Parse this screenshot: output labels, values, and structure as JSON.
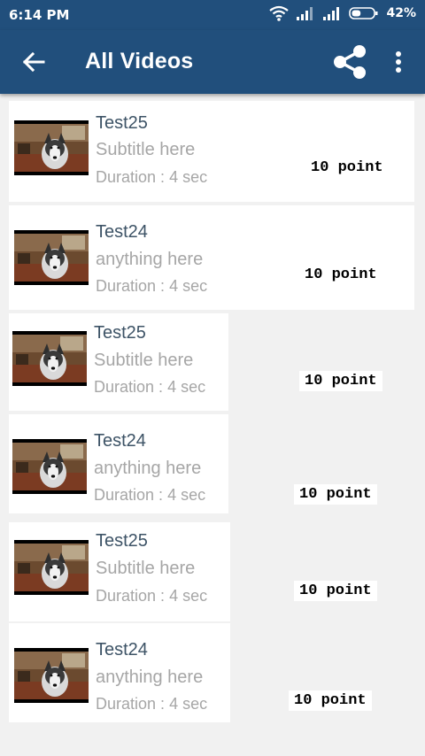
{
  "status_bar": {
    "time": "6:14 PM",
    "battery_percent": "42%",
    "battery_level": 0.42,
    "icons": [
      "wifi-icon",
      "signal-icon",
      "signal-icon",
      "battery-icon"
    ]
  },
  "app_bar": {
    "title": "All Videos",
    "icons": [
      "back-arrow-icon",
      "share-icon",
      "more-vert-icon"
    ]
  },
  "colors": {
    "primary": "#214f7c",
    "title_text": "#3d5366",
    "secondary_text": "#a6a6a6"
  },
  "videos": [
    {
      "title": "Test25",
      "subtitle": "Subtitle here",
      "duration_label": "Duration :",
      "duration_value": "4 sec",
      "points": "10 point"
    },
    {
      "title": "Test24",
      "subtitle": "anything here",
      "duration_label": "Duration :",
      "duration_value": "4 sec",
      "points": "10 point"
    },
    {
      "title": "Test25",
      "subtitle": "Subtitle here",
      "duration_label": "Duration :",
      "duration_value": "4 sec",
      "points": "10 point"
    },
    {
      "title": "Test24",
      "subtitle": "anything here",
      "duration_label": "Duration :",
      "duration_value": "4 sec",
      "points": "10 point"
    },
    {
      "title": "Test25",
      "subtitle": "Subtitle here",
      "duration_label": "Duration :",
      "duration_value": "4 sec",
      "points": "10 point"
    },
    {
      "title": "Test24",
      "subtitle": "anything here",
      "duration_label": "Duration :",
      "duration_value": "4 sec",
      "points": "10 point"
    }
  ]
}
